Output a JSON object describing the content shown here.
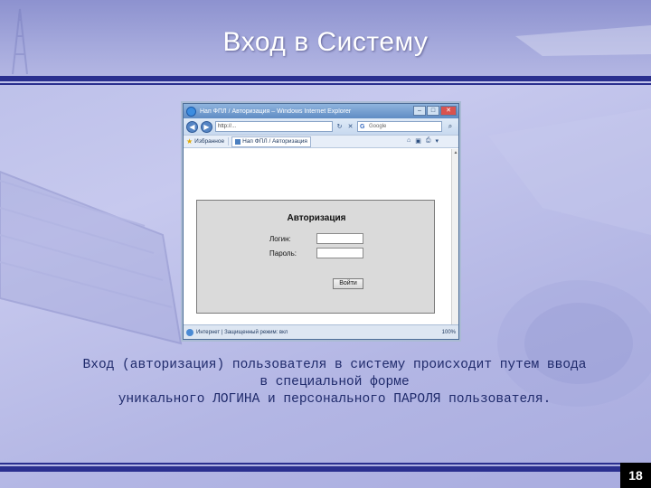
{
  "slide": {
    "title": "Вход в Систему",
    "page_number": "18",
    "caption_lines": [
      "Вход (авторизация) пользователя в систему происходит путем ввода",
      "в специальной форме",
      "уникального ЛОГИНА и персонального ПАРОЛЯ пользователя."
    ]
  },
  "browser": {
    "window_title": "Нап ФПЛ / Авторизация – Windows Internet Explorer",
    "url": "http://...",
    "search_placeholder": "Google",
    "favorites_label": "Избранное",
    "tab_label": "Нап ФПЛ / Авторизация",
    "status_left": "Интернет | Защищенный режим: вкл",
    "zoom": "100%",
    "icons": [
      "ie-logo-icon",
      "back-icon",
      "forward-icon",
      "refresh-icon",
      "stop-icon",
      "search-icon",
      "star-icon",
      "home-icon",
      "feed-icon",
      "print-icon",
      "page-icon",
      "globe-icon"
    ]
  },
  "login_form": {
    "title": "Авторизация",
    "login_label": "Логин:",
    "password_label": "Пароль:",
    "login_value": "",
    "password_value": "",
    "submit_label": "Войти"
  },
  "colors": {
    "accent_rule": "#2a2f8f",
    "background": "#b9bde8",
    "caption_text": "#1f2a6b"
  }
}
